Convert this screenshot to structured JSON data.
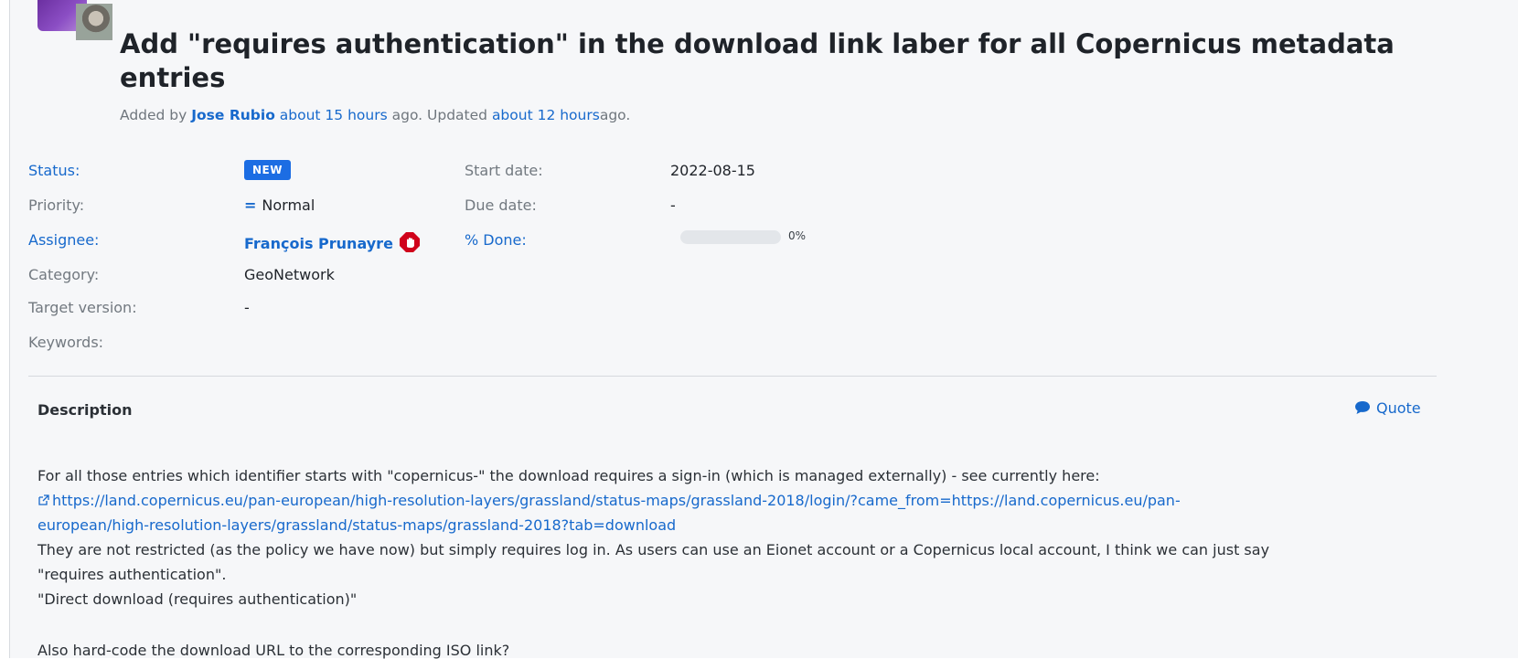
{
  "issue": {
    "title": "Add \"requires authentication\" in the download link laber for all Copernicus metadata entries",
    "meta": {
      "added_prefix": "Added by",
      "author": "Jose Rubio",
      "added_when": "about 15 hours",
      "updated_prefix": "ago. Updated",
      "updated_when": "about 12 hours",
      "suffix": "ago."
    }
  },
  "attributes": {
    "status": {
      "label": "Status:",
      "value": "NEW",
      "color": "#1c6de3"
    },
    "priority": {
      "label": "Priority:",
      "value": "Normal",
      "icon": "equals-icon"
    },
    "assignee": {
      "label": "Assignee:",
      "value": "François Prunayre",
      "icon": "stop-hand-icon",
      "icon_color": "#d0021b"
    },
    "category": {
      "label": "Category:",
      "value": "GeoNetwork"
    },
    "target_version": {
      "label": "Target version:",
      "value": "-"
    },
    "keywords": {
      "label": "Keywords:",
      "value": ""
    },
    "start_date": {
      "label": "Start date:",
      "value": "2022-08-15"
    },
    "due_date": {
      "label": "Due date:",
      "value": "-"
    },
    "done": {
      "label": "% Done:",
      "value_text": "0%",
      "percent": 0
    }
  },
  "description": {
    "heading": "Description",
    "quote_label": "Quote",
    "line1": "For all those entries which identifier starts with \"copernicus-\" the download requires a sign-in (which is managed externally) - see currently here:",
    "link_part1": "https://land.copernicus.eu/pan-european/high-resolution-layers/grassland/status-maps/grassland-2018/login/?came_from=https://land.copernicus.eu/pan-",
    "link_part2": "european/high-resolution-layers/grassland/status-maps/grassland-2018?tab=download",
    "line3": "They are not restricted (as the policy we have now) but simply requires log in. As users can use an Eionet account or a Copernicus local account, I think we can just say",
    "line4": "\"requires authentication\".",
    "line5": "\"Direct download (requires authentication)\"",
    "line6_cut": "Also hard-code the download URL to the corresponding ISO link?"
  },
  "colors": {
    "accent": "#1769cc",
    "background": "#f6f7f9",
    "avatar": "#7a3db0"
  }
}
